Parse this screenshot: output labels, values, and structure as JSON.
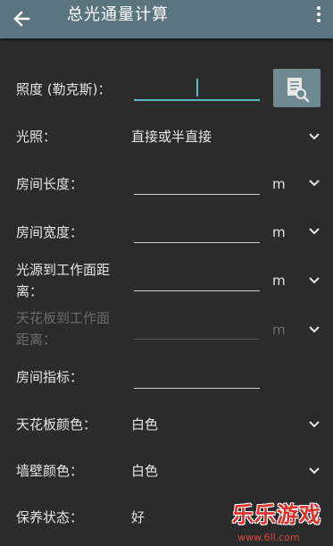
{
  "header": {
    "title": "总光通量计算",
    "back_icon": "arrow-left-icon",
    "menu_icon": "more-vert-icon"
  },
  "form": {
    "illuminance": {
      "label": "照度 (勒克斯)：",
      "value": ""
    },
    "calculate_icon": "calculate-document-search-icon",
    "lighting": {
      "label": "光照：",
      "value": "直接或半直接"
    },
    "room_length": {
      "label": "房间长度：",
      "value": "",
      "unit": "m"
    },
    "room_width": {
      "label": "房间宽度：",
      "value": "",
      "unit": "m"
    },
    "light_height": {
      "label_line1": "光源到工作面距",
      "label_line2": "离：",
      "value": "",
      "unit": "m"
    },
    "ceiling_height": {
      "label_line1": "天花板到工作面",
      "label_line2": "距离：",
      "value": "",
      "unit": "m"
    },
    "room_index": {
      "label": "房间指标：",
      "value": ""
    },
    "ceiling_color": {
      "label": "天花板颜色：",
      "value": "白色"
    },
    "wall_color": {
      "label": "墙壁颜色：",
      "value": "白色"
    },
    "maintenance": {
      "label": "保养状态：",
      "value": "好"
    }
  },
  "watermark": {
    "text": "乐乐游戏",
    "url": "www.6ll.com"
  },
  "colors": {
    "appbar": "#5a7480",
    "background": "#2b2b2b",
    "accent": "#5fb8c6",
    "button": "#6f8993"
  }
}
